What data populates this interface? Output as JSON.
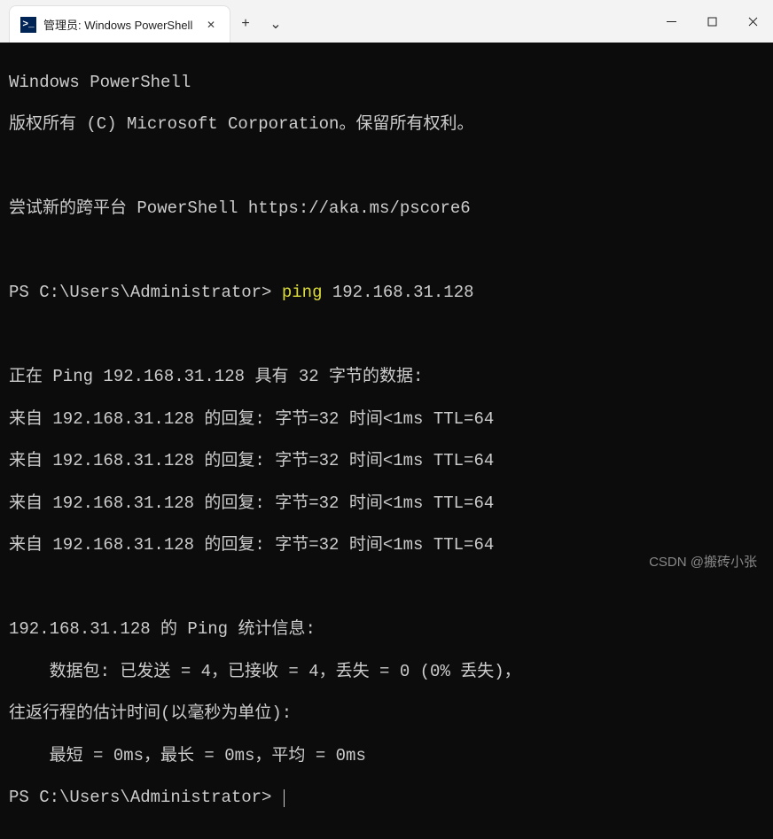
{
  "titlebar": {
    "tab_title": "管理员: Windows PowerShell",
    "tab_icon_text": ">_",
    "close_glyph": "✕",
    "new_tab_glyph": "+",
    "dropdown_glyph": "⌄"
  },
  "terminal": {
    "header1": "Windows PowerShell",
    "header2": "版权所有 (C) Microsoft Corporation。保留所有权利。",
    "header3": "尝试新的跨平台 PowerShell https://aka.ms/pscore6",
    "prompt1_prefix": "PS C:\\Users\\Administrator> ",
    "prompt1_cmd": "ping",
    "prompt1_arg": " 192.168.31.128",
    "ping_intro": "正在 Ping 192.168.31.128 具有 32 字节的数据:",
    "reply1": "来自 192.168.31.128 的回复: 字节=32 时间<1ms TTL=64",
    "reply2": "来自 192.168.31.128 的回复: 字节=32 时间<1ms TTL=64",
    "reply3": "来自 192.168.31.128 的回复: 字节=32 时间<1ms TTL=64",
    "reply4": "来自 192.168.31.128 的回复: 字节=32 时间<1ms TTL=64",
    "stats_header": "192.168.31.128 的 Ping 统计信息:",
    "stats_packets": "    数据包: 已发送 = 4，已接收 = 4，丢失 = 0 (0% 丢失)，",
    "stats_rtt_header": "往返行程的估计时间(以毫秒为单位):",
    "stats_rtt": "    最短 = 0ms，最长 = 0ms，平均 = 0ms",
    "prompt2": "PS C:\\Users\\Administrator> "
  },
  "watermark": "CSDN @搬砖小张"
}
